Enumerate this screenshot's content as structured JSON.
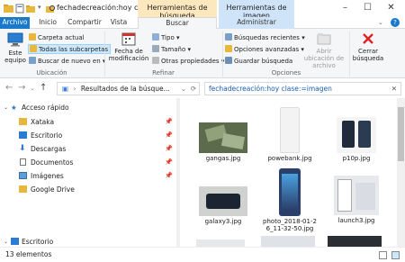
{
  "titlebar": {
    "title": "fechadecreación:hoy clase:...",
    "ctx_search": "Herramientas de búsqueda",
    "ctx_image": "Herramientas de imagen"
  },
  "tabs": {
    "file": "Archivo",
    "home": "Inicio",
    "share": "Compartir",
    "view": "Vista",
    "search": "Buscar",
    "manage": "Administrar"
  },
  "ribbon": {
    "this_pc": "Este equipo",
    "current_folder": "Carpeta actual",
    "all_subfolders": "Todas las subcarpetas",
    "search_again": "Buscar de nuevo en",
    "group_location": "Ubicación",
    "modified_date": "Fecha de modificación",
    "type": "Tipo",
    "size": "Tamaño",
    "other_props": "Otras propiedades",
    "group_refine": "Refinar",
    "recent_searches": "Búsquedas recientes",
    "advanced_options": "Opciones avanzadas",
    "save_search": "Guardar búsqueda",
    "open_file_location": "Abrir ubicación de archivo",
    "group_options": "Opciones",
    "close_search": "Cerrar búsqueda"
  },
  "address": {
    "path": "Resultados de la búsque...",
    "search_query": "fechadecreación:hoy clase:=imagen"
  },
  "nav": {
    "quick_access": "Acceso rápido",
    "items": [
      {
        "label": "Xataka",
        "pinned": true
      },
      {
        "label": "Escritorio",
        "pinned": true
      },
      {
        "label": "Descargas",
        "pinned": true
      },
      {
        "label": "Documentos",
        "pinned": true
      },
      {
        "label": "Imágenes",
        "pinned": true
      },
      {
        "label": "Google Drive",
        "pinned": false
      }
    ],
    "desktop_bottom": "Escritorio"
  },
  "files": [
    {
      "name": "gangas.jpg"
    },
    {
      "name": "powebank.jpg"
    },
    {
      "name": "p10p.jpg"
    },
    {
      "name": "galaxy3.jpg"
    },
    {
      "name": "photo_2018-01-2 6_11-32-50.jpg"
    },
    {
      "name": "launch3.jpg"
    }
  ],
  "status": {
    "count": "13 elementos"
  },
  "colors": {
    "file_tab": "#1979ca",
    "ctx_search": "#fde7bd",
    "ctx_image": "#cfe4f8",
    "selected": "#cce8ff"
  }
}
